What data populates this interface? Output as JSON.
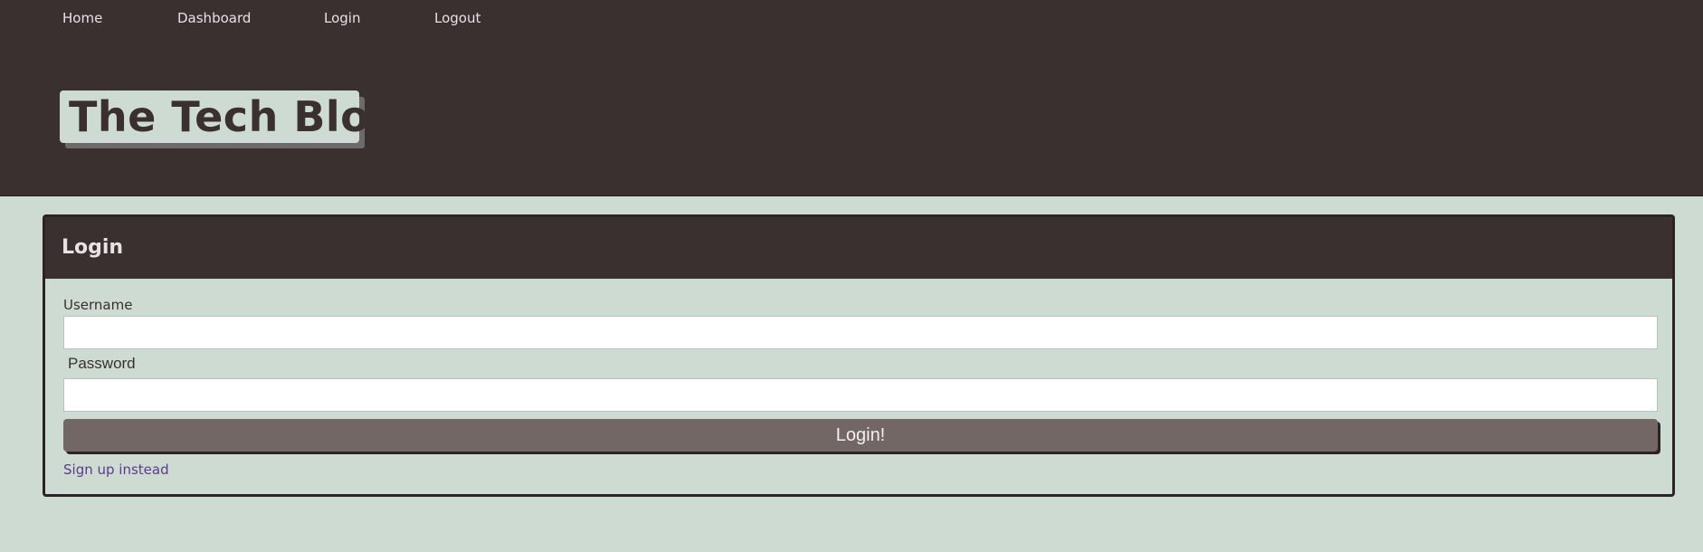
{
  "nav": {
    "home": "Home",
    "dashboard": "Dashboard",
    "login": "Login",
    "logout": "Logout"
  },
  "site": {
    "title": "The Tech Blog"
  },
  "login_card": {
    "title": "Login",
    "username_label": "Username",
    "username_value": "",
    "password_label": "Password",
    "password_value": "",
    "submit_label": "Login!",
    "signup_link": "Sign up instead"
  },
  "colors": {
    "header_bg": "#3a3030",
    "page_bg": "#cddbd3",
    "button_bg": "#726765",
    "link": "#5a3c8a"
  }
}
